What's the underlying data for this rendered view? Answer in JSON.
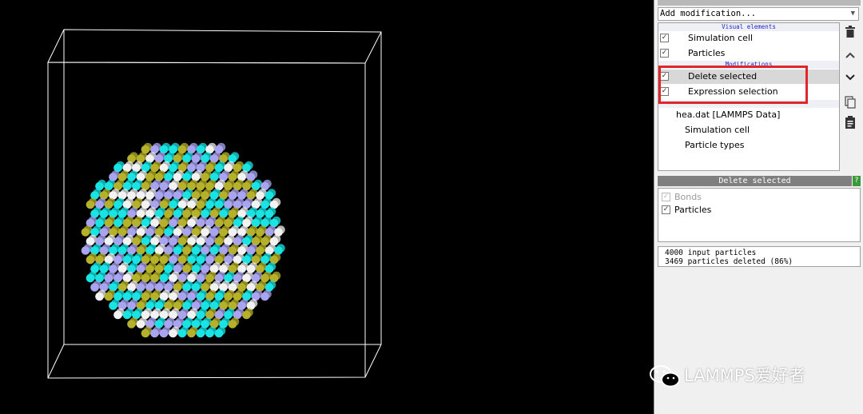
{
  "combo": {
    "label": "Add modification..."
  },
  "pipeline": {
    "section_visual": "Visual elements",
    "section_modifications": "Modifications",
    "items": [
      {
        "label": "Simulation cell",
        "checked": true
      },
      {
        "label": "Particles",
        "checked": true
      },
      {
        "label": "Delete selected",
        "checked": true
      },
      {
        "label": "Expression selection",
        "checked": true
      }
    ],
    "data_source": {
      "label": "hea.dat [LAMMPS Data]"
    },
    "data_children": [
      {
        "label": "Simulation cell"
      },
      {
        "label": "Particle types"
      }
    ]
  },
  "properties": {
    "title": "Delete selected",
    "help": "?",
    "options": [
      {
        "label": "Bonds",
        "checked": true,
        "enabled": false
      },
      {
        "label": "Particles",
        "checked": true,
        "enabled": true
      }
    ]
  },
  "status": {
    "line1": "4000 input particles",
    "line2": "3469 particles deleted (86%)"
  },
  "watermark": {
    "text": "LAMMPS爱好者"
  },
  "colors": {
    "particle_cyan": "#19e3e3",
    "particle_olive": "#b5b12a",
    "particle_lavender": "#a9a4f0",
    "particle_white": "#f2f2f2",
    "highlight": "#e0262b"
  }
}
